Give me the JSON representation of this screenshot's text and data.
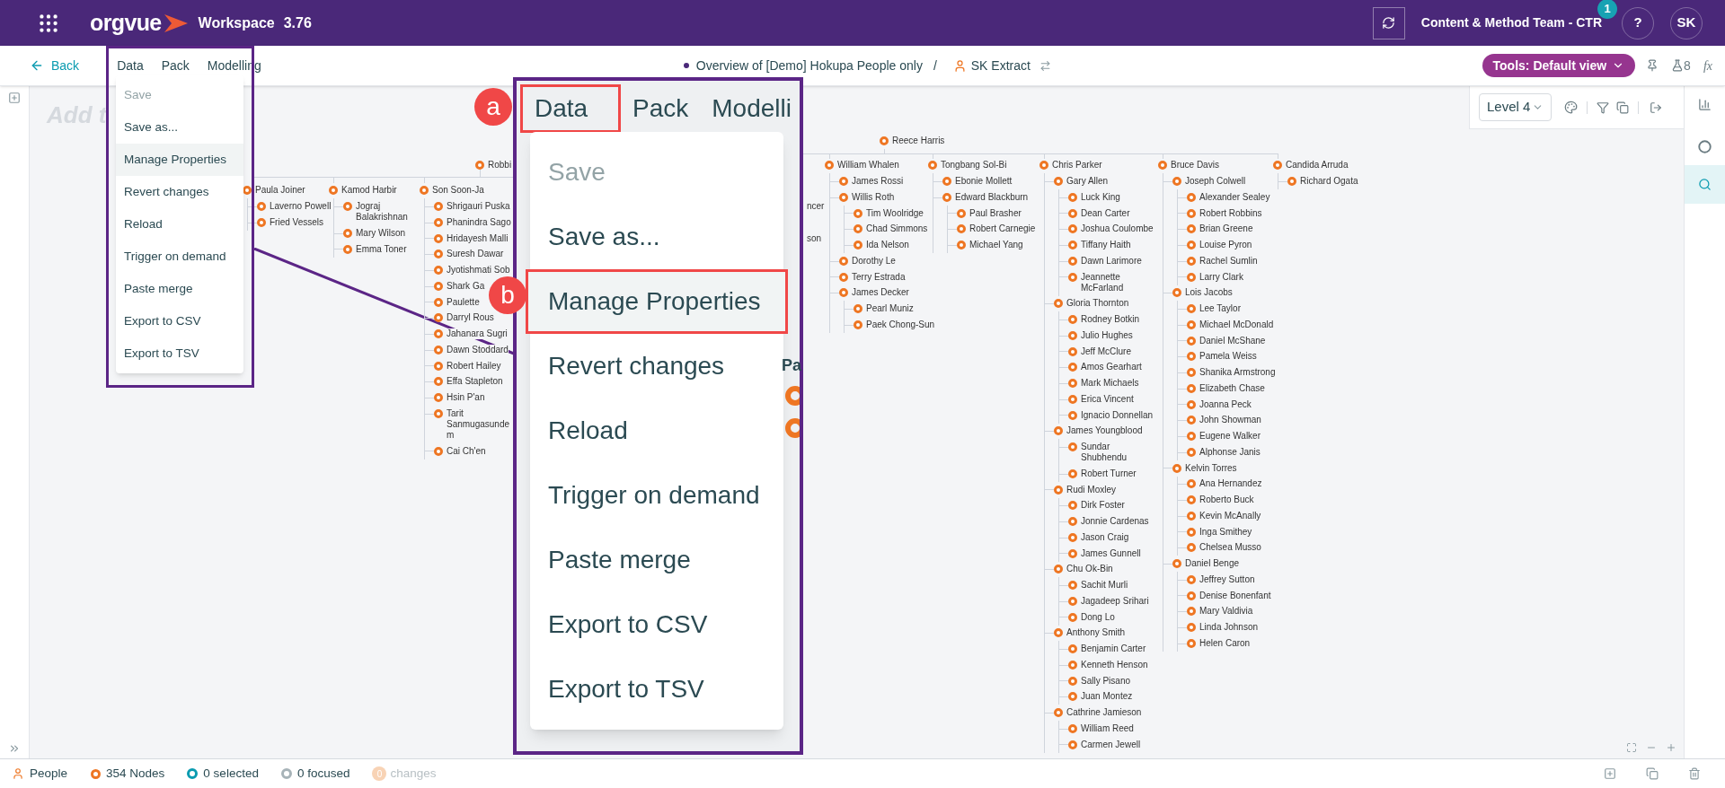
{
  "app": {
    "logo": "orgvue",
    "product": "Workspace",
    "version": "3.76",
    "team": "Content & Method Team - CTR",
    "notification_count": "1",
    "help": "?",
    "avatar": "SK"
  },
  "toolbar": {
    "back": "Back",
    "menus": [
      {
        "label": "Data"
      },
      {
        "label": "Pack"
      },
      {
        "label": "Modelling"
      }
    ],
    "dataset": "Overview of [Demo] Hokupa People only",
    "separator": "/",
    "view": "SK Extract",
    "tools": "Tools: Default view",
    "lens_count": "8",
    "formula": "fx"
  },
  "data_menu": {
    "items": [
      {
        "label": "Save",
        "disabled": true,
        "highlighted": false
      },
      {
        "label": "Save as...",
        "disabled": false,
        "highlighted": false
      },
      {
        "label": "Manage Properties",
        "disabled": false,
        "highlighted": true
      },
      {
        "label": "Revert changes",
        "disabled": false,
        "highlighted": false
      },
      {
        "label": "Reload",
        "disabled": false,
        "highlighted": false
      },
      {
        "label": "Trigger on demand",
        "disabled": false,
        "highlighted": false
      },
      {
        "label": "Paste merge",
        "disabled": false,
        "highlighted": false
      },
      {
        "label": "Export to CSV",
        "disabled": false,
        "highlighted": false
      },
      {
        "label": "Export to TSV",
        "disabled": false,
        "highlighted": false
      }
    ]
  },
  "canvas": {
    "heading": "Add t",
    "level_select": "Level 4",
    "tree_left": {
      "name": "Robbi",
      "children": [
        {
          "name": "Paula Joiner",
          "children": [
            {
              "name": "Laverno Powell"
            },
            {
              "name": "Fried Vessels"
            }
          ]
        },
        {
          "name": "Kamod Harbir",
          "children": [
            {
              "name": "Jograj Balakrishnan"
            },
            {
              "name": "Mary Wilson"
            },
            {
              "name": "Emma Toner"
            }
          ]
        },
        {
          "name": "Son Soon-Ja",
          "children": [
            {
              "name": "Shrigauri Puska"
            },
            {
              "name": "Phanindra Sago"
            },
            {
              "name": "Hridayesh Malli"
            },
            {
              "name": "Suresh Dawar"
            },
            {
              "name": "Jyotishmati Sob"
            },
            {
              "name": "Shark Ga"
            },
            {
              "name": "Paulette"
            },
            {
              "name": "Darryl Rous"
            },
            {
              "name": "Jahanara Sugri"
            },
            {
              "name": "Dawn Stoddard"
            },
            {
              "name": "Robert Hailey"
            },
            {
              "name": "Effa Stapleton"
            },
            {
              "name": "Hsin P'an"
            },
            {
              "name": "Tarit Sanmugasunde m"
            },
            {
              "name": "Cai Ch'en"
            }
          ]
        }
      ]
    },
    "partial_labels": [
      "ncer",
      "son"
    ],
    "tree_right": {
      "name": "Reece Harris",
      "children": [
        {
          "name": "William Whalen",
          "children": [
            {
              "name": "James Rossi"
            },
            {
              "name": "Willis Roth",
              "children": [
                {
                  "name": "Tim Woolridge"
                },
                {
                  "name": "Chad Simmons"
                },
                {
                  "name": "Ida Nelson"
                }
              ]
            },
            {
              "name": "Dorothy Le"
            },
            {
              "name": "Terry Estrada"
            },
            {
              "name": "James Decker",
              "children": [
                {
                  "name": "Pearl Muniz"
                },
                {
                  "name": "Paek Chong-Sun"
                }
              ]
            }
          ]
        },
        {
          "name": "Tongbang Sol-Bi",
          "children": [
            {
              "name": "Ebonie Mollett"
            },
            {
              "name": "Edward Blackburn",
              "children": [
                {
                  "name": "Paul Brasher"
                },
                {
                  "name": "Robert Carnegie"
                },
                {
                  "name": "Michael Yang"
                }
              ]
            }
          ]
        },
        {
          "name": "Chris Parker",
          "children": [
            {
              "name": "Gary Allen",
              "children": [
                {
                  "name": "Luck King"
                },
                {
                  "name": "Dean Carter"
                },
                {
                  "name": "Joshua Coulombe"
                },
                {
                  "name": "Tiffany Haith"
                },
                {
                  "name": "Dawn Larimore"
                },
                {
                  "name": "Jeannette McFarland"
                }
              ]
            },
            {
              "name": "Gloria Thornton",
              "children": [
                {
                  "name": "Rodney Botkin"
                },
                {
                  "name": "Julio Hughes"
                },
                {
                  "name": "Jeff McClure"
                },
                {
                  "name": "Amos Gearhart"
                },
                {
                  "name": "Mark Michaels"
                },
                {
                  "name": "Erica Vincent"
                },
                {
                  "name": "Ignacio Donnellan"
                }
              ]
            },
            {
              "name": "James Youngblood",
              "children": [
                {
                  "name": "Sundar Shubhendu"
                },
                {
                  "name": "Robert Turner"
                }
              ]
            },
            {
              "name": "Rudi Moxley",
              "children": [
                {
                  "name": "Dirk Foster"
                },
                {
                  "name": "Jonnie Cardenas"
                },
                {
                  "name": "Jason Craig"
                },
                {
                  "name": "James Gunnell"
                }
              ]
            },
            {
              "name": "Chu Ok-Bin",
              "children": [
                {
                  "name": "Sachit Murli"
                },
                {
                  "name": "Jagadeep Srihari"
                },
                {
                  "name": "Dong Lo"
                }
              ]
            },
            {
              "name": "Anthony Smith",
              "children": [
                {
                  "name": "Benjamin Carter"
                },
                {
                  "name": "Kenneth Henson"
                },
                {
                  "name": "Sally Pisano"
                },
                {
                  "name": "Juan Montez"
                }
              ]
            },
            {
              "name": "Cathrine Jamieson",
              "children": [
                {
                  "name": "William Reed"
                },
                {
                  "name": "Carmen Jewell"
                }
              ]
            }
          ]
        },
        {
          "name": "Bruce Davis",
          "children": [
            {
              "name": "Joseph Colwell",
              "children": [
                {
                  "name": "Alexander Sealey"
                },
                {
                  "name": "Robert Robbins"
                },
                {
                  "name": "Brian Greene"
                },
                {
                  "name": "Louise Pyron"
                },
                {
                  "name": "Rachel Sumlin"
                },
                {
                  "name": "Larry Clark"
                }
              ]
            },
            {
              "name": "Lois Jacobs",
              "children": [
                {
                  "name": "Lee Taylor"
                },
                {
                  "name": "Michael McDonald"
                },
                {
                  "name": "Daniel McShane"
                },
                {
                  "name": "Pamela Weiss"
                },
                {
                  "name": "Shanika Armstrong"
                },
                {
                  "name": "Elizabeth Chase"
                },
                {
                  "name": "Joanna Peck"
                },
                {
                  "name": "John Showman"
                },
                {
                  "name": "Eugene Walker"
                },
                {
                  "name": "Alphonse Janis"
                }
              ]
            },
            {
              "name": "Kelvin Torres",
              "children": [
                {
                  "name": "Ana Hernandez"
                },
                {
                  "name": "Roberto Buck"
                },
                {
                  "name": "Kevin McAnally"
                },
                {
                  "name": "Inga Smithey"
                },
                {
                  "name": "Chelsea Musso"
                }
              ]
            },
            {
              "name": "Daniel Benge",
              "children": [
                {
                  "name": "Jeffrey Sutton"
                },
                {
                  "name": "Denise Bonenfant"
                },
                {
                  "name": "Mary Valdivia"
                },
                {
                  "name": "Linda Johnson"
                },
                {
                  "name": "Helen Caron"
                }
              ]
            }
          ]
        },
        {
          "name": "Candida Arruda",
          "children": [
            {
              "name": "Richard Ogata"
            }
          ]
        }
      ]
    }
  },
  "callout": {
    "menus": [
      {
        "label": "Data",
        "annotation": "a"
      },
      {
        "label": "Pack"
      },
      {
        "label": "Modelli"
      }
    ],
    "items": [
      {
        "label": "Save",
        "disabled": true,
        "highlighted": false
      },
      {
        "label": "Save as...",
        "disabled": false,
        "highlighted": false
      },
      {
        "label": "Manage Properties",
        "disabled": false,
        "highlighted": true,
        "annotation": "b"
      },
      {
        "label": "Revert changes",
        "disabled": false,
        "highlighted": false
      },
      {
        "label": "Reload",
        "disabled": false,
        "highlighted": false
      },
      {
        "label": "Trigger on demand",
        "disabled": false,
        "highlighted": false
      },
      {
        "label": "Paste merge",
        "disabled": false,
        "highlighted": false
      },
      {
        "label": "Export to CSV",
        "disabled": false,
        "highlighted": false
      },
      {
        "label": "Export to TSV",
        "disabled": false,
        "highlighted": false
      }
    ],
    "background_text": "Pa"
  },
  "status_bar": {
    "dataset": "People",
    "nodes": "354 Nodes",
    "selected": "0 selected",
    "focused": "0 focused",
    "changes": {
      "count": "0",
      "label": "changes",
      "disabled": true
    }
  }
}
